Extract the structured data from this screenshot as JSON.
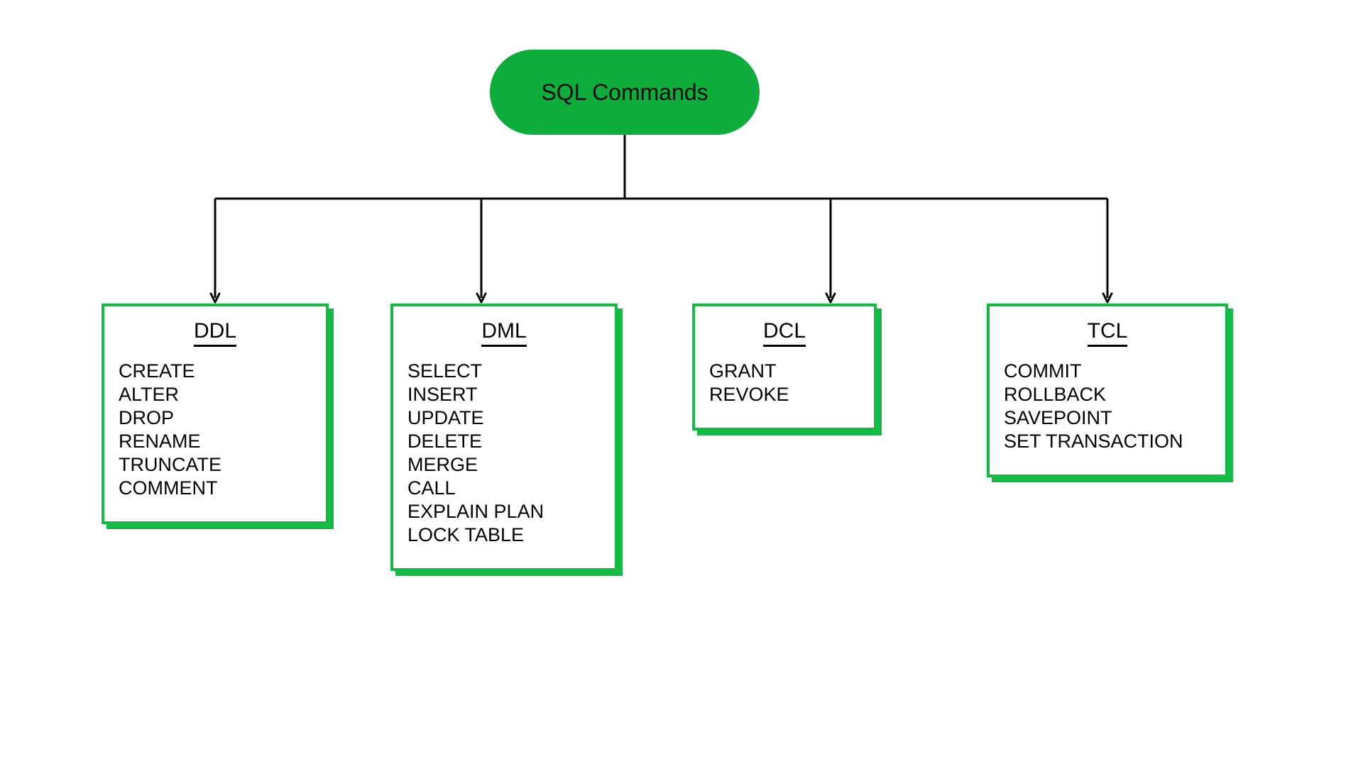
{
  "root": {
    "label": "SQL Commands"
  },
  "categories": [
    {
      "key": "ddl",
      "title": "DDL",
      "items": [
        "CREATE",
        "ALTER",
        "DROP",
        "RENAME",
        "TRUNCATE",
        "COMMENT"
      ]
    },
    {
      "key": "dml",
      "title": "DML",
      "items": [
        "SELECT",
        "INSERT",
        "UPDATE",
        "DELETE",
        "MERGE",
        "CALL",
        "EXPLAIN PLAN",
        "LOCK TABLE"
      ]
    },
    {
      "key": "dcl",
      "title": "DCL",
      "items": [
        "GRANT",
        "REVOKE"
      ]
    },
    {
      "key": "tcl",
      "title": "TCL",
      "items": [
        "COMMIT",
        "ROLLBACK",
        "SAVEPOINT",
        "SET TRANSACTION"
      ]
    }
  ],
  "colors": {
    "green": "#13bb44",
    "rootFill": "#0eac3a"
  }
}
